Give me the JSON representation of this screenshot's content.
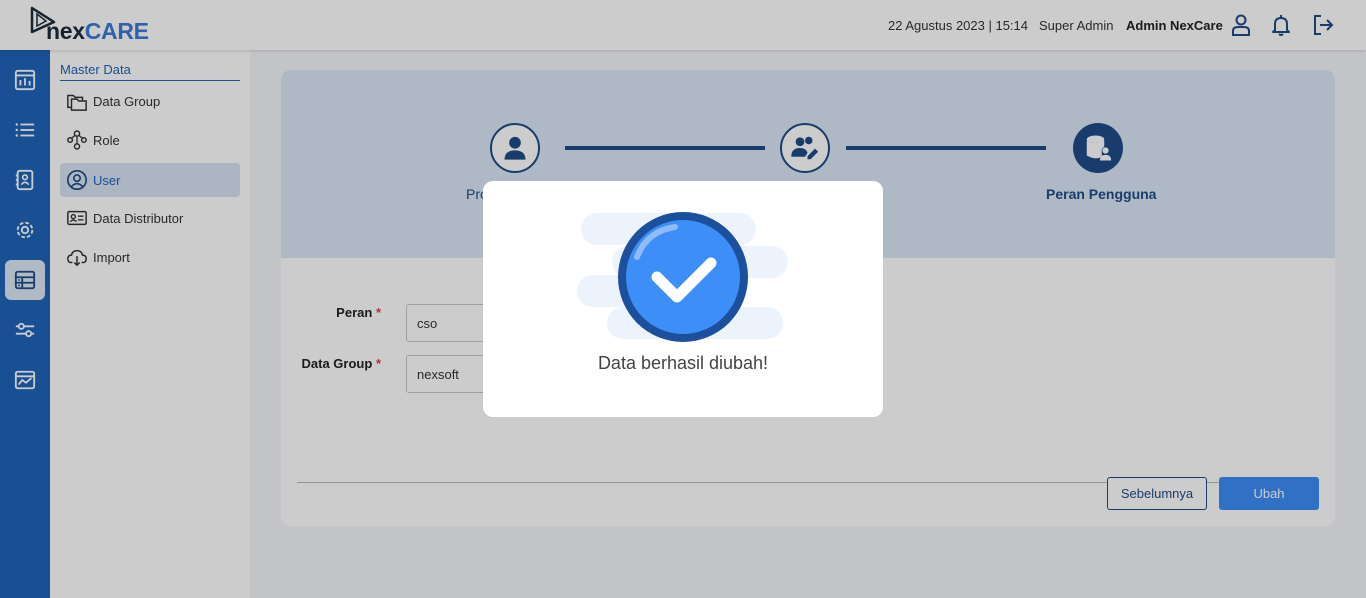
{
  "header": {
    "logo": {
      "part1": "nex",
      "part2": "CARE"
    },
    "datetime": "22 Agustus 2023 | 15:14",
    "role": "Super Admin",
    "user_name": "Admin NexCare",
    "icons": [
      "user-icon",
      "bell-icon",
      "logout-icon"
    ]
  },
  "rail": {
    "icons": [
      "dashboard-icon",
      "list-icon",
      "contacts-icon",
      "settings-icon",
      "master-data-icon",
      "sliders-icon",
      "report-icon"
    ],
    "active_index": 4
  },
  "submenu": {
    "title": "Master Data",
    "items": [
      {
        "label": "Data Group",
        "icon": "folders-icon"
      },
      {
        "label": "Role",
        "icon": "network-icon"
      },
      {
        "label": "User",
        "icon": "user-circle-icon"
      },
      {
        "label": "Data Distributor",
        "icon": "id-card-icon"
      },
      {
        "label": "Import",
        "icon": "cloud-download-icon"
      }
    ],
    "active_label": "User"
  },
  "stepper": {
    "steps": [
      {
        "label": "Pro",
        "icon": "profile-icon"
      },
      {
        "label": "",
        "icon": "user-edit-icon"
      },
      {
        "label": "Peran Pengguna",
        "icon": "database-user-icon"
      }
    ]
  },
  "form": {
    "fields": [
      {
        "label": "Peran",
        "value": "cso"
      },
      {
        "label": "Data Group",
        "value": "nexsoft"
      }
    ],
    "required_mark": "*",
    "prev_label": "Sebelumnya",
    "save_label": "Ubah"
  },
  "modal": {
    "message": "Data berhasil diubah!",
    "icon": "success-check-icon"
  },
  "colors": {
    "primary": "#1f64b8",
    "dark_primary": "#1f4b86",
    "accent": "#3c8ef7",
    "required": "#e04040"
  }
}
